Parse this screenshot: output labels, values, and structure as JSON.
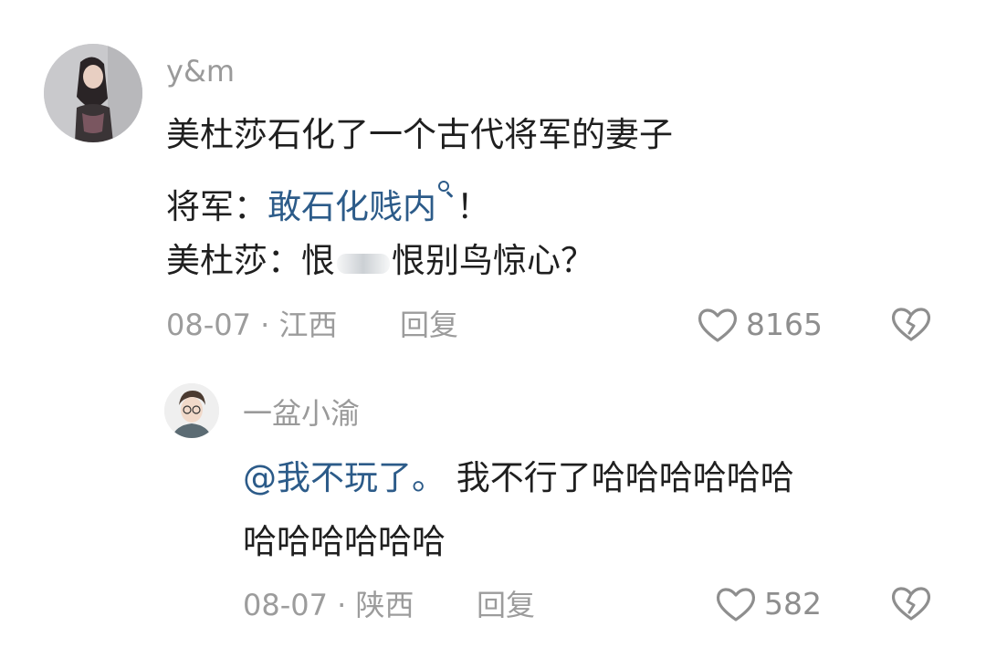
{
  "comments": [
    {
      "username": "y&m",
      "lines": {
        "line1": "美杜莎石化了一个古代将军的妻子",
        "line2_prefix": "将军：",
        "line2_link": "敢石化贱内",
        "line2_suffix": "！",
        "line3_prefix": "美杜莎：恨",
        "line3_suffix": "恨别鸟惊心？"
      },
      "meta": "08-07 · 江西",
      "reply_label": "回复",
      "likes": "8165"
    }
  ],
  "replies": [
    {
      "username": "一盆小渝",
      "mention": "@我不玩了。",
      "text_line1": " 我不行了哈哈哈哈哈哈",
      "text_line2": "哈哈哈哈哈哈",
      "meta": "08-07 · 陕西",
      "reply_label": "回复",
      "likes": "582"
    }
  ],
  "colors": {
    "link": "#2c5b89",
    "muted": "#9c9c9c",
    "text": "#1f1f1f"
  },
  "icons": [
    "heart-outline-icon",
    "broken-heart-icon",
    "search-icon"
  ]
}
